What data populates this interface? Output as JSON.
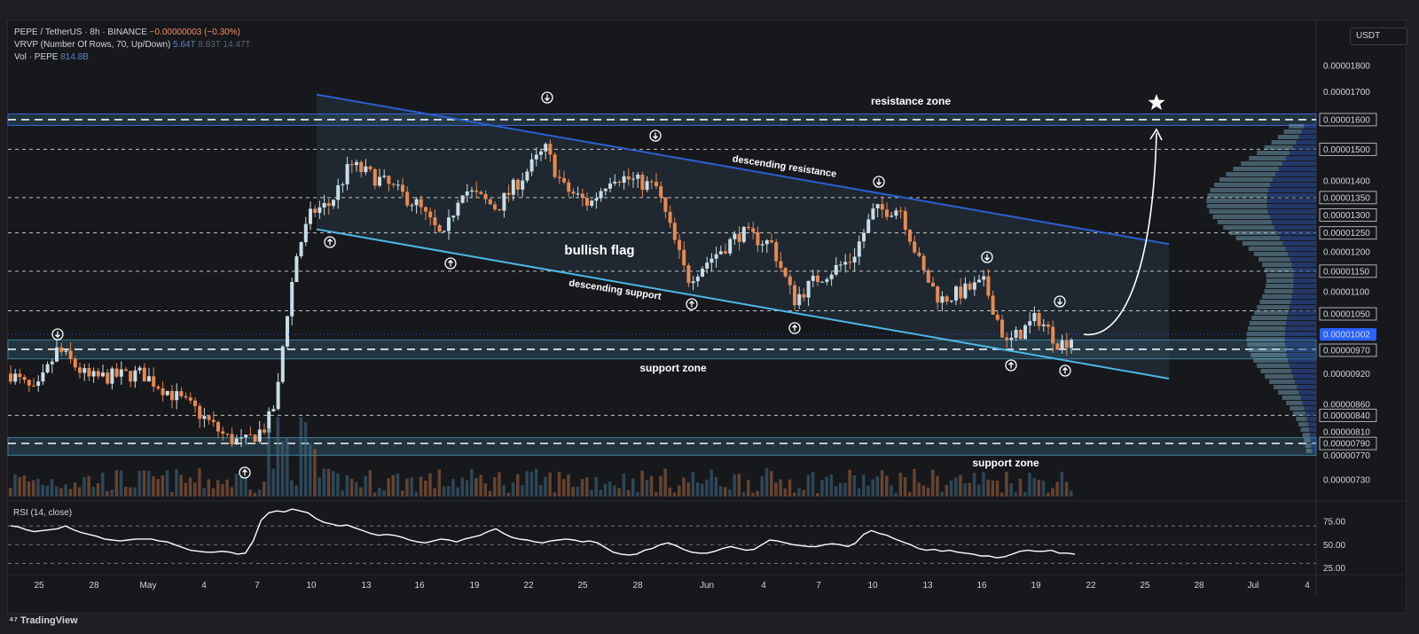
{
  "header": {
    "symbol_line_parts": [
      "PEPE / TetherUS · 8h · BINANCE ",
      "−0.00000003 (−0.30%)"
    ],
    "vrvp_parts": [
      "VRVP (Number Of Rows, 70, Up/Down) ",
      "5.64T",
      " 8.83T",
      " 14.47T"
    ],
    "vol_parts": [
      "Vol · PEPE ",
      "814.8B"
    ]
  },
  "currency_label": "USDT",
  "rsi_label": "RSI (14, close)",
  "brand": "TradingView",
  "colors": {
    "up": "#c8dde6",
    "down": "#e8894f",
    "background": "#17181c",
    "channel_fill": "#2b3b4c",
    "resistance_line": "#2c5fd0",
    "support_line": "#4fb8e8",
    "zone_fill": "#2c4c5c",
    "last_price_tag": "#2962ff"
  },
  "annotations": {
    "bullish_flag": "bullish flag",
    "resistance_zone": "resistance zone",
    "support_zone_1": "support zone",
    "support_zone_2": "support zone",
    "descending_resistance": "descending resistance",
    "descending_support": "descending support"
  },
  "icons": [
    "arrow-down-circle-icon",
    "arrow-up-circle-icon",
    "star-icon",
    "curved-arrow-icon"
  ],
  "chart_data": {
    "type": "candlestick",
    "title": "PEPE / TetherUS · 8h · BINANCE",
    "y_axis": {
      "scale": "log",
      "tick_labels": [
        "0.00001800",
        "0.00001700",
        "0.00001600",
        "0.00001500",
        "0.00001400",
        "0.00001350",
        "0.00001300",
        "0.00001250",
        "0.00001200",
        "0.00001150",
        "0.00001100",
        "0.00001050",
        "0.00001002",
        "0.00000970",
        "0.00000920",
        "0.00000860",
        "0.00000840",
        "0.00000810",
        "0.00000790",
        "0.00000770",
        "0.00000730"
      ],
      "boxed_levels": [
        "0.00001600",
        "0.00001500",
        "0.00001350",
        "0.00001300",
        "0.00001250",
        "0.00001150",
        "0.00001050",
        "0.00000970",
        "0.00000840",
        "0.00000790"
      ],
      "last_price": "0.00001002"
    },
    "x_axis": {
      "tick_labels": [
        "25",
        "28",
        "May",
        "4",
        "7",
        "10",
        "13",
        "16",
        "19",
        "22",
        "25",
        "28",
        "Jun",
        "4",
        "7",
        "10",
        "13",
        "16",
        "19",
        "22",
        "25",
        "28",
        "Jul",
        "4"
      ]
    },
    "horizontal_levels": [
      1.6e-05,
      1.5e-05,
      1.35e-05,
      1.25e-05,
      1.15e-05,
      1.055e-05,
      9.7e-06,
      8.4e-06,
      7.9e-06
    ],
    "zones": [
      {
        "name": "resistance zone",
        "from": 1.58e-05,
        "to": 1.62e-05
      },
      {
        "name": "support zone",
        "from": 9.5e-06,
        "to": 9.9e-06
      },
      {
        "name": "support zone",
        "from": 7.7e-06,
        "to": 8e-06
      }
    ],
    "trendlines": [
      {
        "name": "descending resistance",
        "start": [
          "May 10",
          1.69e-05
        ],
        "end": [
          "Jun 26",
          1.22e-05
        ]
      },
      {
        "name": "descending support",
        "start": [
          "May 10",
          1.26e-05
        ],
        "end": [
          "Jun 26",
          9.1e-06
        ]
      }
    ],
    "pattern": {
      "name": "bullish flag",
      "from": "May 10",
      "to": "Jun 26"
    },
    "projection": {
      "from": 1e-05,
      "to": 1.5e-05
    },
    "rsi": {
      "label": "RSI (14, close)",
      "tick_labels": [
        "75.00",
        "50.00",
        "25.00"
      ],
      "levels": [
        70,
        50,
        30
      ],
      "values": [
        70,
        69,
        66,
        64,
        65,
        66,
        67,
        70,
        66,
        63,
        61,
        59,
        56,
        55,
        54,
        55,
        56,
        56,
        56,
        54,
        53,
        50,
        47,
        44,
        43,
        42,
        42,
        43,
        42,
        40,
        41,
        54,
        76,
        84,
        86,
        85,
        88,
        86,
        84,
        78,
        74,
        72,
        70,
        71,
        68,
        65,
        62,
        60,
        61,
        60,
        58,
        55,
        53,
        52,
        54,
        56,
        55,
        53,
        56,
        58,
        60,
        64,
        67,
        62,
        58,
        56,
        55,
        53,
        52,
        54,
        55,
        56,
        55,
        53,
        54,
        52,
        47,
        42,
        40,
        39,
        40,
        44,
        46,
        50,
        52,
        49,
        45,
        42,
        41,
        41,
        43,
        46,
        48,
        46,
        44,
        45,
        50,
        55,
        54,
        52,
        50,
        49,
        48,
        48,
        50,
        51,
        50,
        48,
        52,
        61,
        65,
        62,
        60,
        56,
        53,
        50,
        46,
        44,
        45,
        43,
        44,
        42,
        41,
        40,
        38,
        38,
        36,
        37,
        40,
        43,
        44,
        43,
        43,
        44,
        41,
        41,
        40
      ]
    },
    "price_range_shown": [
      7.3e-06,
      1.85e-05
    ]
  }
}
